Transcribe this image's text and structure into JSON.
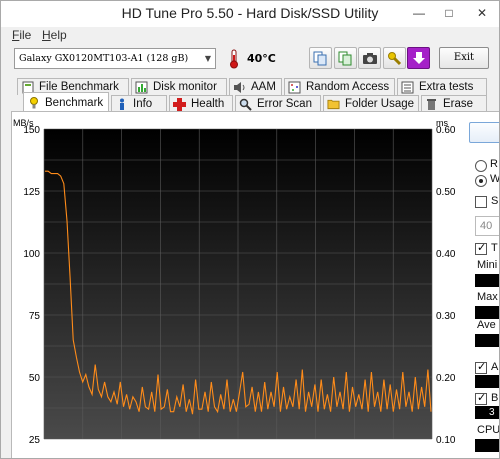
{
  "window": {
    "title": "HD Tune Pro 5.50 - Hard Disk/SSD Utility"
  },
  "menu": {
    "file": "File",
    "file_key": "F",
    "file_rest": "ile",
    "help_key": "H",
    "help_rest": "elp"
  },
  "toolbar": {
    "drive": "Galaxy GX0120MT103-A1 (128 gB)",
    "temperature": "40°C",
    "exit_label": "Exit"
  },
  "tabs_top": [
    "File Benchmark",
    "Disk monitor",
    "AAM",
    "Random Access",
    "Extra tests"
  ],
  "tabs_bottom": [
    "Benchmark",
    "Info",
    "Health",
    "Error Scan",
    "Folder Usage",
    "Erase"
  ],
  "side": {
    "radio1": "R",
    "radio2": "W",
    "check_s": "S",
    "value_40": "40",
    "check_t": "T",
    "min_label": "Mini",
    "max_label": "Max",
    "avg_label": "Ave",
    "check_a": "A",
    "check_b": "B",
    "b_value": "3",
    "cpu_label": "CPU"
  },
  "chart_data": {
    "type": "line",
    "ylabel": "MB/s",
    "y2label": "ms",
    "ylim": [
      25,
      150
    ],
    "y2lim": [
      0.1,
      0.6
    ],
    "yticks": [
      "150",
      "125",
      "100",
      "75",
      "50",
      "25"
    ],
    "y2ticks": [
      "0.60",
      "0.50",
      "0.40",
      "0.30",
      "0.20",
      "0.10"
    ],
    "grid": true,
    "series": [
      {
        "color": "#ff8c1a",
        "values": [
          133,
          133,
          132,
          132,
          132,
          131,
          128,
          113,
          90,
          65,
          58,
          52,
          48,
          51,
          46,
          43,
          55,
          45,
          42,
          48,
          42,
          40,
          44,
          39,
          48,
          38,
          43,
          37,
          42,
          40,
          36,
          46,
          38,
          37,
          44,
          36,
          51,
          37,
          38,
          45,
          36,
          36,
          42,
          38,
          47,
          36,
          41,
          35,
          49,
          37,
          37,
          44,
          36,
          48,
          38,
          36,
          43,
          37,
          49,
          36,
          41,
          36,
          44,
          52,
          38,
          39,
          46,
          36,
          44,
          36,
          48,
          37,
          44,
          38,
          52,
          36,
          46,
          37,
          42,
          38,
          49,
          37,
          53,
          36,
          44,
          38,
          47,
          36,
          49,
          37,
          43,
          36,
          50,
          38,
          44,
          37,
          52,
          36,
          46,
          38,
          43,
          37,
          49,
          36,
          52,
          38,
          44,
          36,
          49,
          37,
          47,
          36,
          45,
          37,
          52,
          38,
          44,
          36,
          50,
          37,
          46,
          38,
          53,
          36
        ]
      }
    ]
  }
}
